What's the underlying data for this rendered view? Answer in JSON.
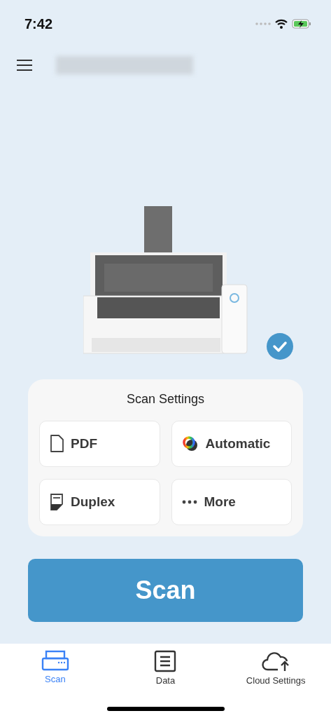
{
  "status_bar": {
    "time": "7:42"
  },
  "device": {
    "connected": true
  },
  "scan_settings": {
    "title": "Scan Settings",
    "options": [
      {
        "kind": "file",
        "label": "PDF"
      },
      {
        "kind": "color",
        "label": "Automatic"
      },
      {
        "kind": "duplex",
        "label": "Duplex"
      },
      {
        "kind": "more",
        "label": "More"
      }
    ]
  },
  "scan_button": {
    "label": "Scan"
  },
  "tabs": [
    {
      "kind": "scan",
      "label": "Scan",
      "selected": true
    },
    {
      "kind": "data",
      "label": "Data",
      "selected": false
    },
    {
      "kind": "cloud",
      "label": "Cloud Settings",
      "selected": false
    }
  ]
}
